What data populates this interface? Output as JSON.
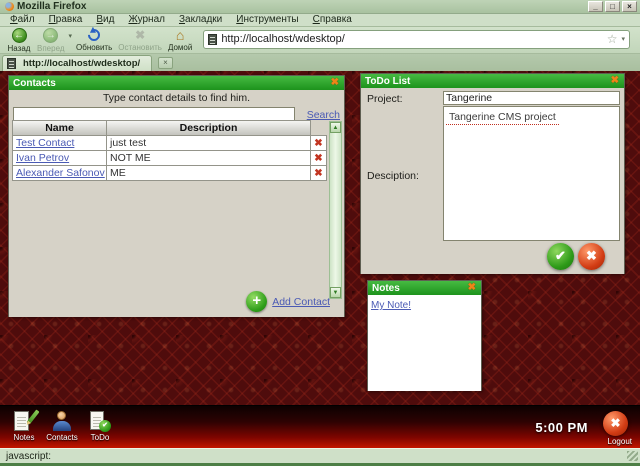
{
  "browser": {
    "window_title": "Mozilla Firefox",
    "menu": [
      "Файл",
      "Правка",
      "Вид",
      "Журнал",
      "Закладки",
      "Инструменты",
      "Справка"
    ],
    "toolbar": {
      "back": "Назад",
      "forward": "Вперед",
      "reload": "Обновить",
      "stop": "Остановить",
      "home": "Домой"
    },
    "address": "http://localhost/wdesktop/",
    "tab_title": "http://localhost/wdesktop/",
    "status_text": "javascript:"
  },
  "contacts": {
    "title": "Contacts",
    "hint": "Type contact details to find him.",
    "search_link": "Search",
    "columns": {
      "name": "Name",
      "description": "Description"
    },
    "rows": [
      {
        "name": "Test Contact",
        "description": "just test"
      },
      {
        "name": "Ivan Petrov",
        "description": "NOT ME"
      },
      {
        "name": "Alexander Safonov",
        "description": "ME"
      }
    ],
    "add_link": "Add Contact"
  },
  "todo": {
    "title": "ToDo List",
    "project_label": "Project:",
    "project_value": "Tangerine",
    "suggestion": "Tangerine CMS project",
    "description_label": "Desciption:"
  },
  "notes": {
    "title": "Notes",
    "note": "My Note!"
  },
  "taskbar": {
    "items": [
      {
        "label": "Notes"
      },
      {
        "label": "Contacts"
      },
      {
        "label": "ToDo"
      }
    ],
    "clock": "5:00 PM",
    "logout_label": "Logout"
  },
  "icons": {
    "close": "✖",
    "delete": "✖",
    "check": "✔",
    "cancel": "✖",
    "add": "+",
    "back": "←",
    "forward": "→",
    "stop": "✖",
    "star": "☆",
    "caret": "▾",
    "home": "⌂",
    "scroll_up": "▲",
    "scroll_down": "▼",
    "minimize": "_",
    "maximize": "□",
    "window_close": "×",
    "tab_close": "×",
    "logout": "✖"
  },
  "colors": {
    "window_accent_green": "#22a022",
    "desktop_red": "#4f0c0c",
    "link_blue": "#4a5ab4",
    "chrome_green": "#c9dbc3",
    "taskbar_red": "#c41500"
  }
}
